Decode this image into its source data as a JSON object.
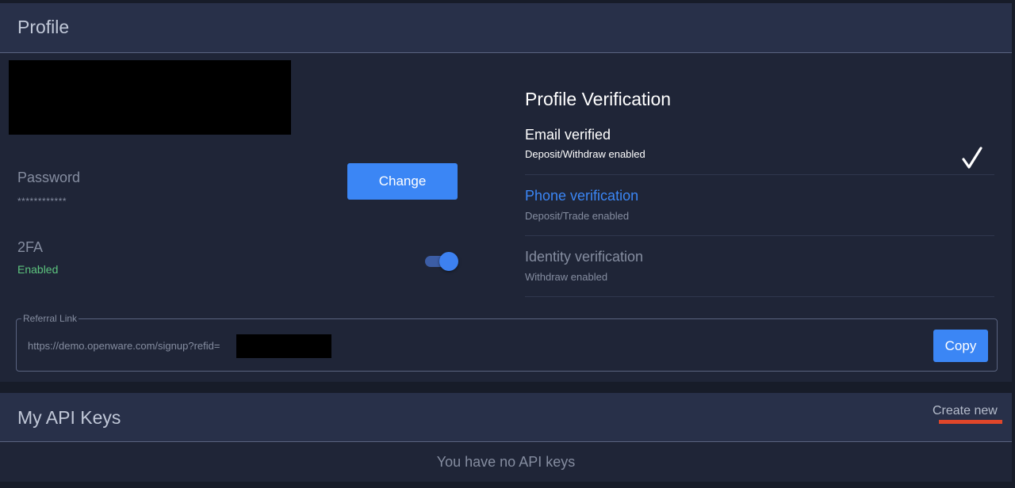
{
  "profile": {
    "title": "Profile",
    "password": {
      "label": "Password",
      "value": "************",
      "change_label": "Change"
    },
    "twofa": {
      "label": "2FA",
      "status": "Enabled",
      "toggle_on": true
    },
    "verification": {
      "title": "Profile Verification",
      "items": [
        {
          "title": "Email verified",
          "subtitle": "Deposit/Withdraw enabled",
          "verified": true,
          "check_icon": "checkmark-icon"
        },
        {
          "title": "Phone verification",
          "subtitle": "Deposit/Trade enabled"
        },
        {
          "title": "Identity verification",
          "subtitle": "Withdraw enabled"
        }
      ]
    },
    "referral": {
      "legend": "Referral Link",
      "url": "https://demo.openware.com/signup?refid=",
      "copy_label": "Copy"
    }
  },
  "api_keys": {
    "title": "My API Keys",
    "create_label": "Create new",
    "empty_text": "You have no API keys"
  },
  "colors": {
    "background": "#171c29",
    "card": "#1f2537",
    "header": "#283049",
    "accent": "#3b86f5",
    "success": "#5dc47e",
    "highlight": "#e0462a"
  }
}
